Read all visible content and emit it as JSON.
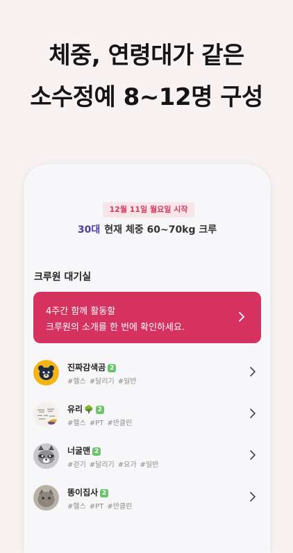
{
  "headline": {
    "line1": "체중, 연령대가 같은",
    "line2": "소수정예 8~12명 구성"
  },
  "crew": {
    "start_date": "12월 11일 월요일 시작",
    "age": "30대",
    "condition": "현재 체중 60~70kg 크루",
    "section_title": "크루원 대기실",
    "banner_line1": "4주간 함께 활동할",
    "banner_line2": "크루원의 소개를 한 번에 확인하세요."
  },
  "members": [
    {
      "name": "진짜감색곰",
      "level": "2",
      "tags": [
        "#헬스",
        "#달리기",
        "#일반"
      ],
      "avatar": "bear-icon"
    },
    {
      "name": "유리",
      "level": "2",
      "tags": [
        "#헬스",
        "#PT",
        "#반클린"
      ],
      "avatar": "handwritten-note-photo"
    },
    {
      "name": "너굴맨",
      "level": "2",
      "tags": [
        "#걷기",
        "#달리기",
        "#요가",
        "#일반"
      ],
      "avatar": "raccoon-icon"
    },
    {
      "name": "똥이집사",
      "level": "2",
      "tags": [
        "#헬스",
        "#PT",
        "#반클린"
      ],
      "avatar": "cat-photo"
    }
  ],
  "colors": {
    "accent": "#d63260",
    "age_highlight": "#4b3ca7",
    "level_badge": "#6bc36c"
  }
}
